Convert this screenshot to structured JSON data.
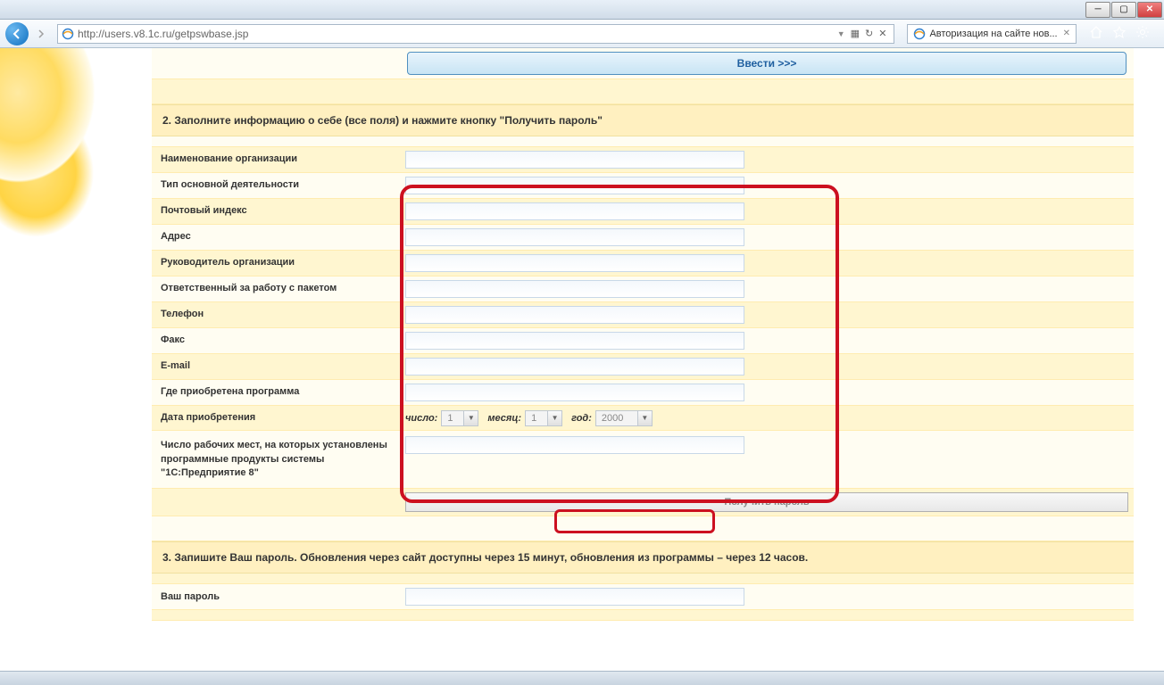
{
  "browser": {
    "url": "http://users.v8.1c.ru/getpswbase.jsp",
    "tab_title": "Авторизация на сайте нов..."
  },
  "top_button": "Ввести >>>",
  "section2_title": "2. Заполните информацию о себе (все поля) и нажмите кнопку \"Получить пароль\"",
  "fields": {
    "org_name": "Наименование организации",
    "activity_type": "Тип основной деятельности",
    "postal": "Почтовый индекс",
    "address": "Адрес",
    "head": "Руководитель организации",
    "responsible": "Ответственный за работу с пакетом",
    "phone": "Телефон",
    "fax": "Факс",
    "email": "E-mail",
    "purchased": "Где приобретена программа",
    "purchase_date": "Дата приобретения",
    "workplaces": "Число рабочих мест, на которых установлены программные продукты системы \"1С:Предприятие 8\""
  },
  "date": {
    "day_label": "число:",
    "month_label": "месяц:",
    "year_label": "год:",
    "day": "1",
    "month": "1",
    "year": "2000"
  },
  "submit_label": "Получить пароль",
  "section3_title": "3. Запишите Ваш пароль. Обновления через сайт доступны через 15 минут, обновления из программы – через 12 часов.",
  "password_label": "Ваш пароль"
}
